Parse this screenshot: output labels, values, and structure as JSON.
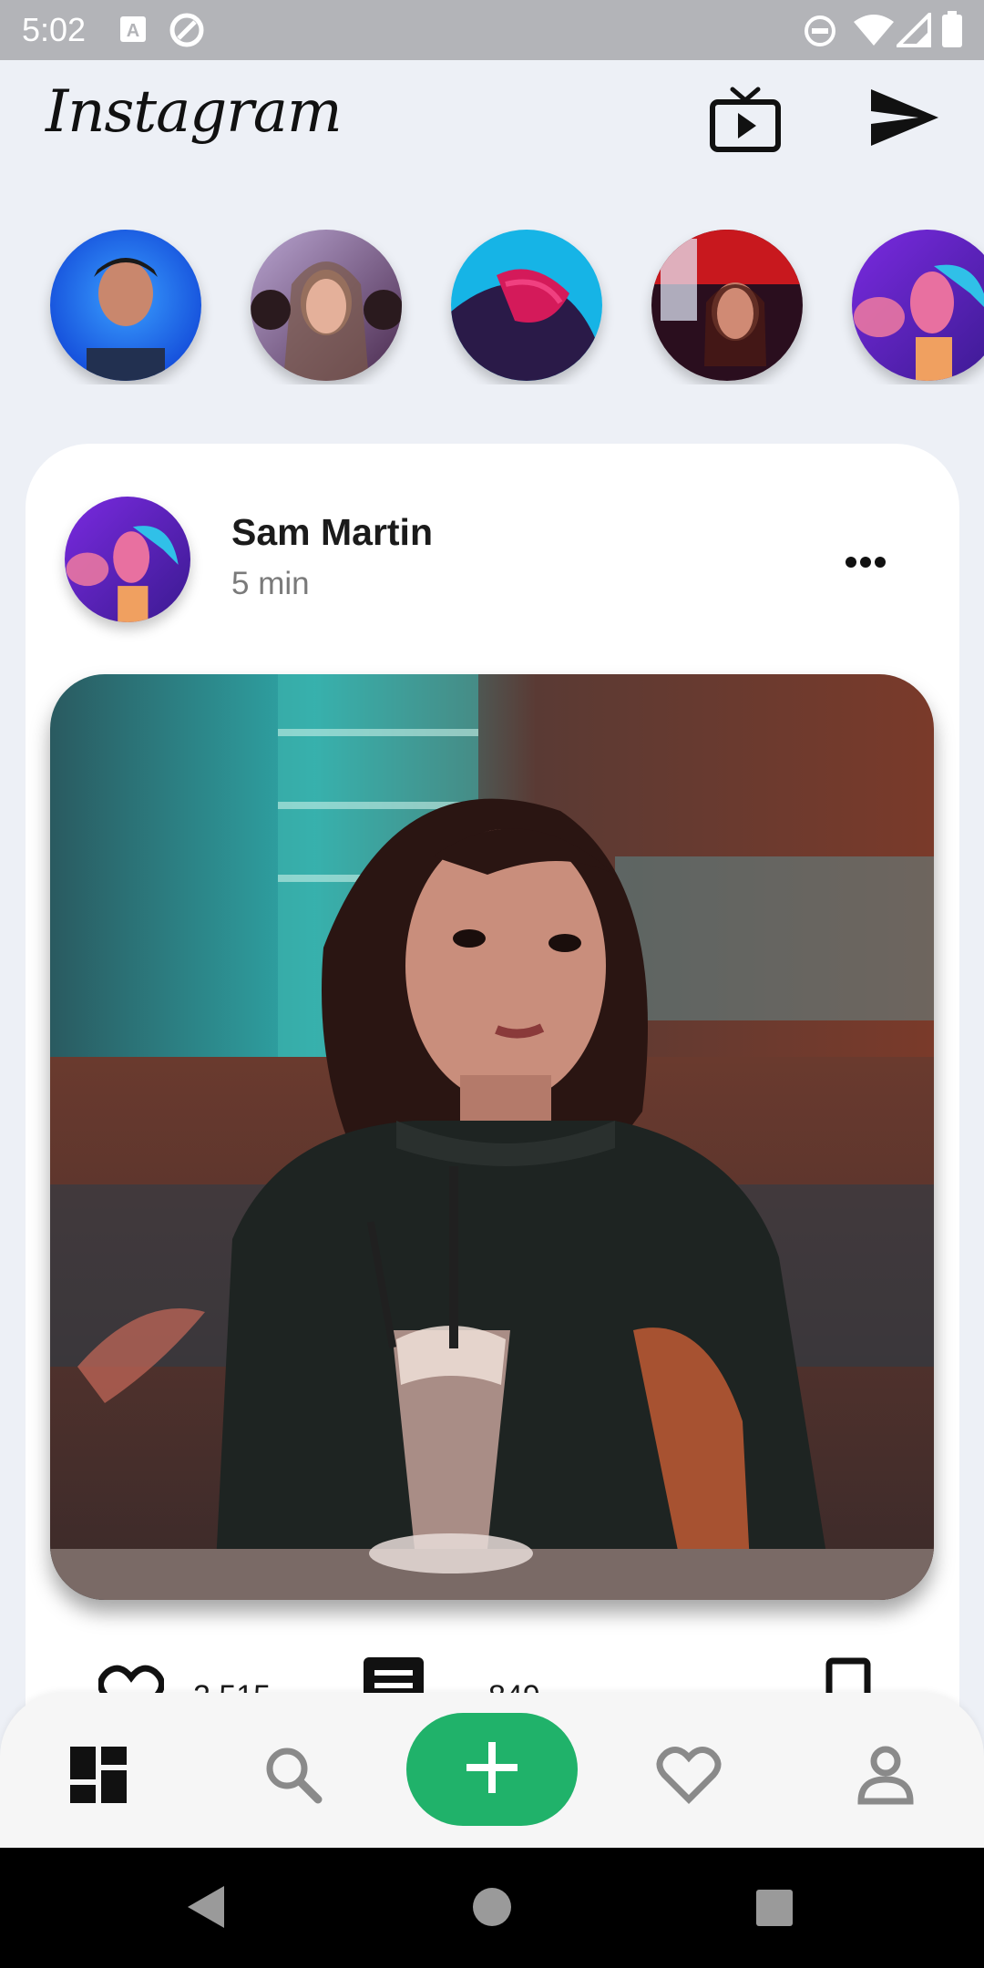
{
  "status_bar": {
    "time": "5:02",
    "icons": [
      "a11y-a-icon",
      "at-sign-icon",
      "do-not-disturb-icon",
      "wifi-icon",
      "signal-icon",
      "battery-icon"
    ]
  },
  "header": {
    "logo": "Instagram",
    "icons": [
      "tv-icon",
      "send-icon"
    ]
  },
  "stories": [
    {
      "name": "story-1",
      "colors": [
        "#1560f0",
        "#3aa0ff"
      ]
    },
    {
      "name": "story-2",
      "colors": [
        "#6b5a8c",
        "#c08a9a"
      ]
    },
    {
      "name": "story-3",
      "colors": [
        "#18b7e8",
        "#c8185a"
      ]
    },
    {
      "name": "story-4",
      "colors": [
        "#d2202a",
        "#3b1030"
      ]
    },
    {
      "name": "story-5",
      "colors": [
        "#8a35d8",
        "#f0508a"
      ]
    }
  ],
  "post": {
    "author": "Sam Martin",
    "time": "5 min",
    "likes": "2,515",
    "comments": "849"
  },
  "bottom_nav": {
    "items": [
      "dashboard-icon",
      "search-icon",
      "add-icon",
      "heart-icon",
      "profile-icon"
    ],
    "accent": "#20b26a"
  }
}
